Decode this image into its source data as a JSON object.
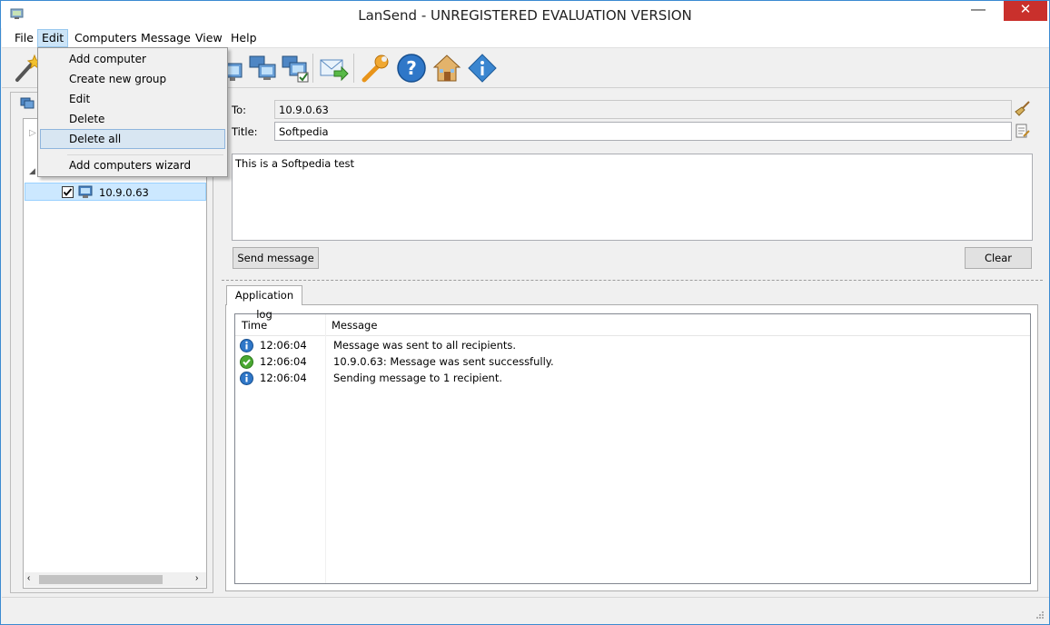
{
  "window": {
    "title": "LanSend - UNREGISTERED EVALUATION VERSION",
    "minimize": "—",
    "close": "✕"
  },
  "menubar": {
    "items": [
      "File",
      "Edit",
      "Computers",
      "Message",
      "View",
      "Help"
    ],
    "active": "Edit"
  },
  "edit_menu": {
    "items": [
      "Add computer",
      "Create new group",
      "Edit",
      "Delete",
      "Delete all",
      "Add computers wizard"
    ],
    "highlighted": "Delete all"
  },
  "toolbar": {
    "icons": [
      "wizard-icon",
      "add-computer-icon",
      "computers-icon",
      "computer-check-icon",
      "send-message-icon",
      "settings-wrench-icon",
      "help-icon",
      "home-icon",
      "info-icon"
    ]
  },
  "tree": {
    "selected_node": "10.9.0.63",
    "checked": true
  },
  "compose": {
    "to_label": "To:",
    "to_value": "10.9.0.63",
    "title_label": "Title:",
    "title_value": "Softpedia",
    "body": "This is a Softpedia test",
    "send_button": "Send message",
    "clear_button": "Clear"
  },
  "log": {
    "tab": "Application log",
    "columns": [
      "Time",
      "Message"
    ],
    "rows": [
      {
        "icon": "info-icon",
        "time": "12:06:04",
        "message": "Message was sent to all recipients."
      },
      {
        "icon": "success-check-icon",
        "time": "12:06:04",
        "message": "10.9.0.63: Message was sent successfully."
      },
      {
        "icon": "info-icon",
        "time": "12:06:04",
        "message": "Sending message to 1 recipient."
      }
    ]
  },
  "colors": {
    "selection": "#cce8ff",
    "close_button": "#c9302c",
    "info_blue": "#2f77c8",
    "success_green": "#4aa832"
  }
}
